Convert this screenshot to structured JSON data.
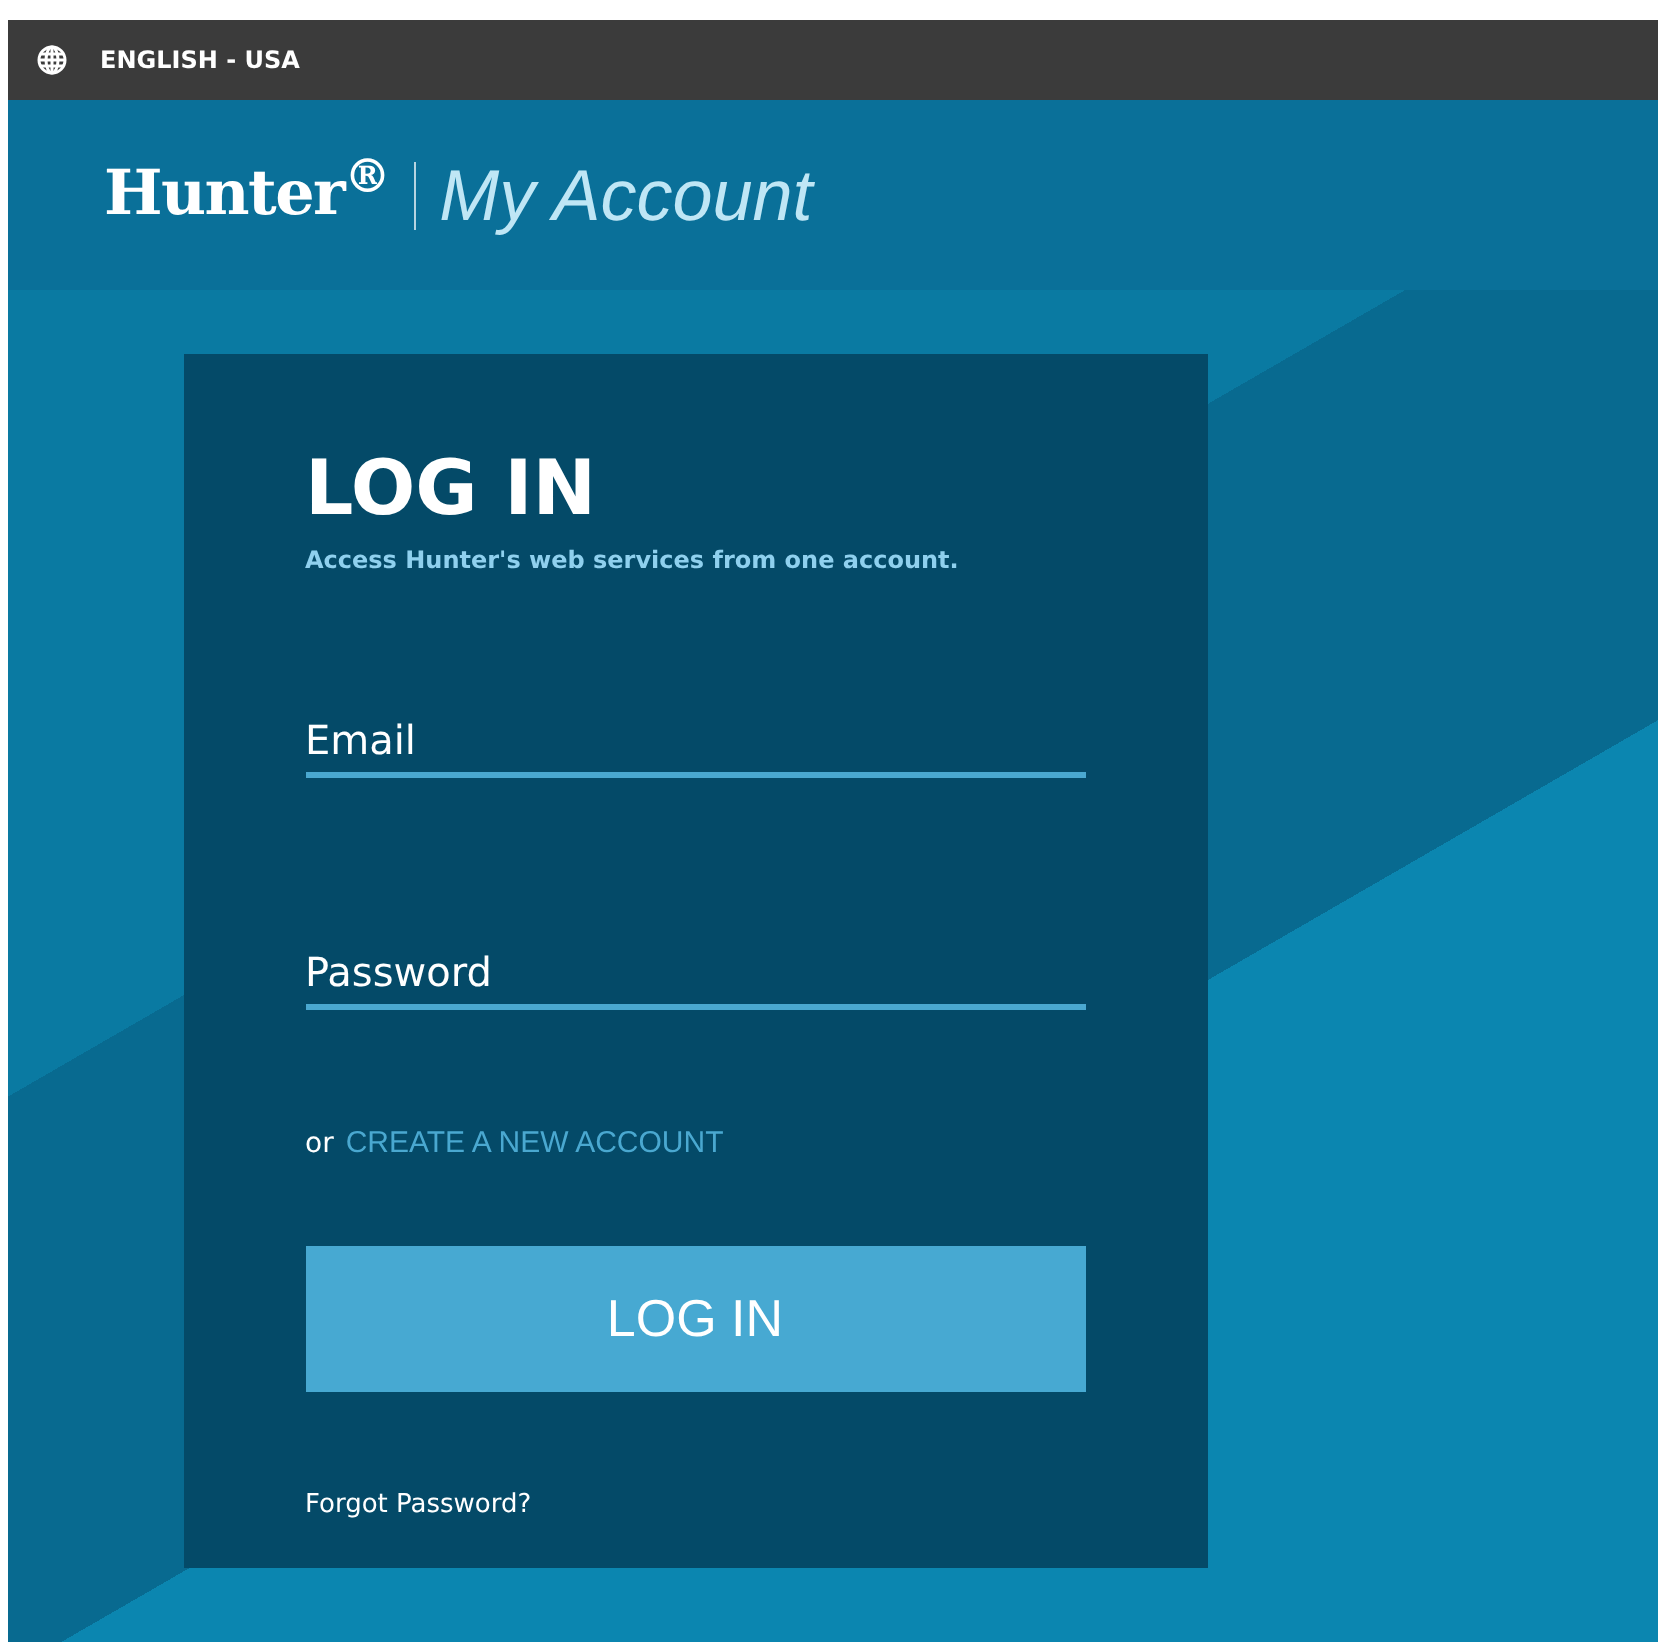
{
  "top_bar": {
    "language": "ENGLISH - USA"
  },
  "header": {
    "brand": "Hunter$^{®}$",
    "product": "My Account"
  },
  "login": {
    "title": "LOG IN",
    "subtitle": "Access Hunter's web services from one account.",
    "fields": [
      {
        "placeholder": "Email"
      },
      {
        "placeholder": "Password"
      }
    ],
    "create_prefix": "or",
    "create_link": "CREATE A NEW ACCOUNT",
    "submit": "LOG IN",
    "forgot": "Forgot Password?"
  }
}
